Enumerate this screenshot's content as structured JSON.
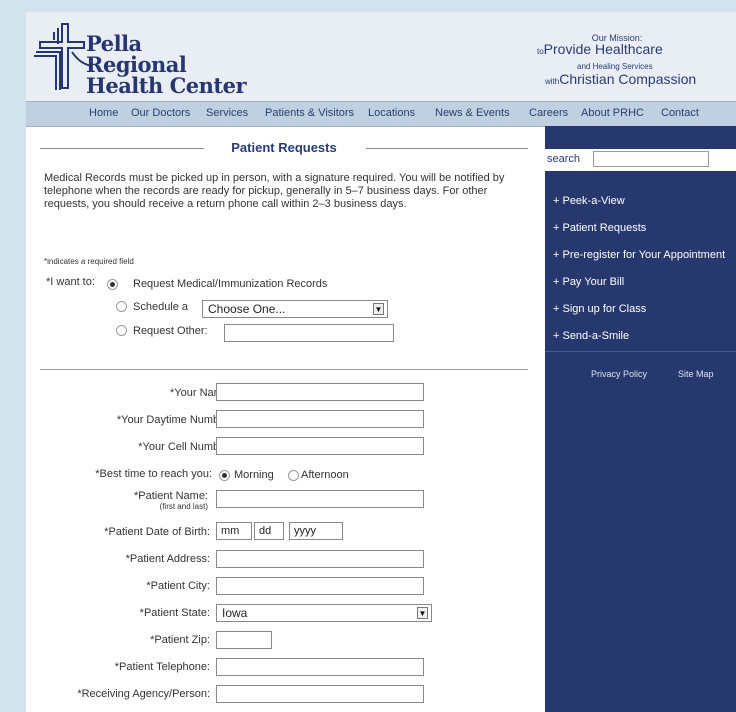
{
  "brand": {
    "line1": "Pella",
    "line2": "Regional",
    "line3": "Health Center"
  },
  "mission": {
    "line1": "Our Mission:",
    "line2_small": "to",
    "line2_big": "Provide Healthcare",
    "line3": "and Healing Services",
    "line4_small": "with",
    "line4_big": "Christian Compassion"
  },
  "nav": [
    "Home",
    "Our Doctors",
    "Services",
    "Patients & Visitors",
    "Locations",
    "News & Events",
    "Careers",
    "About PRHC",
    "Contact"
  ],
  "main": {
    "title": "Patient Requests",
    "intro": "Medical Records must be picked up in person, with a signature required. You will be notified by telephone when the records are ready for pickup, generally in 5–7 business days. For other requests, you should receive a return phone call within 2–3 business days.",
    "required_note": "*indicates a required field",
    "want_label": "*I want to:",
    "option1": "Request Medical/Immunization Records",
    "option2": "Schedule a",
    "option2_select": "Choose One...",
    "option3": "Request Other:"
  },
  "form": {
    "your_name": "*Your Name:",
    "daytime": "*Your Daytime Number:",
    "cell": "*Your Cell Number:",
    "best_time": "*Best time to reach you:",
    "morning": "Morning",
    "afternoon": "Afternoon",
    "patient_name": "*Patient Name:",
    "patient_name_sub": "(first and last)",
    "dob": "*Patient Date of Birth:",
    "dob_mm": "mm",
    "dob_dd": "dd",
    "dob_yyyy": "yyyy",
    "address": "*Patient Address:",
    "city": "*Patient City:",
    "state": "*Patient State:",
    "state_value": "Iowa",
    "zip": "*Patient Zip:",
    "telephone": "*Patient Telephone:",
    "agency": "*Receiving Agency/Person:"
  },
  "sidebar": {
    "search_label": "search",
    "links": [
      "+ Peek-a-View",
      "+ Patient Requests",
      "+ Pre-register for Your Appointment",
      "+ Pay Your Bill",
      "+ Sign up for Class",
      "+ Send-a-Smile"
    ],
    "privacy": "Privacy Policy",
    "sitemap": "Site Map"
  },
  "colors": {
    "brand_navy": "#26386e",
    "nav_bg": "#bfd0e1",
    "page_bg": "#d3e3ee"
  }
}
